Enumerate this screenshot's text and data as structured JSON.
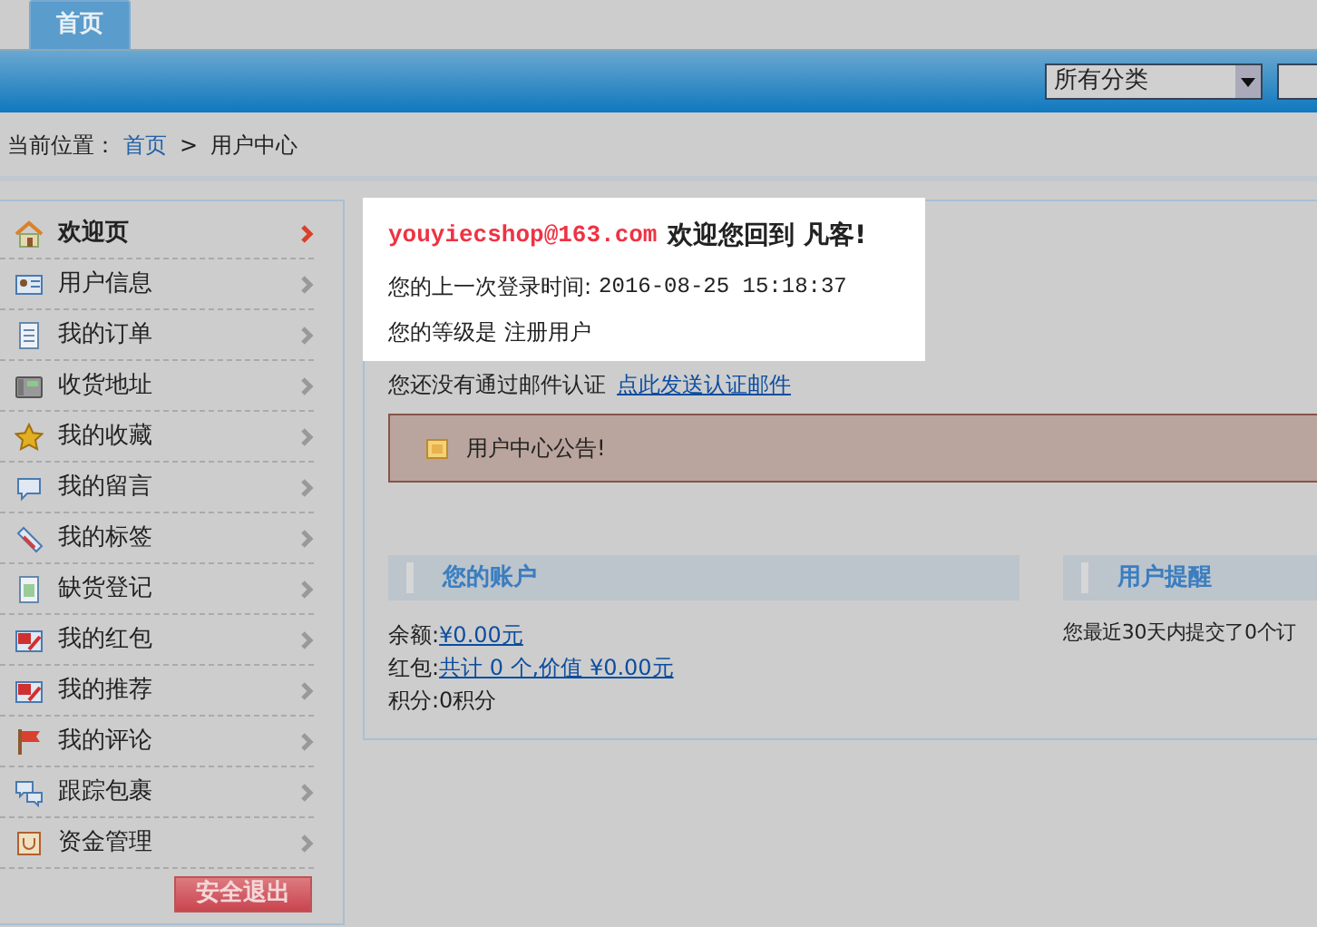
{
  "tabs": [
    {
      "label": "首页",
      "selected": true
    }
  ],
  "search": {
    "category": "所有分类"
  },
  "breadcrumb": {
    "label": "当前位置：",
    "home": "首页",
    "separator": ">",
    "current": "用户中心"
  },
  "sidebar": {
    "items": [
      {
        "label": "欢迎页",
        "selected": true
      },
      {
        "label": "用户信息",
        "selected": false
      },
      {
        "label": "我的订单",
        "selected": false
      },
      {
        "label": "收货地址",
        "selected": false
      },
      {
        "label": "我的收藏",
        "selected": false
      },
      {
        "label": "我的留言",
        "selected": false
      },
      {
        "label": "我的标签",
        "selected": false
      },
      {
        "label": "缺货登记",
        "selected": false
      },
      {
        "label": "我的红包",
        "selected": false
      },
      {
        "label": "我的推荐",
        "selected": false
      },
      {
        "label": "我的评论",
        "selected": false
      },
      {
        "label": "跟踪包裹",
        "selected": false
      },
      {
        "label": "资金管理",
        "selected": false
      }
    ],
    "logout": "安全退出"
  },
  "welcome": {
    "email": "youyiecshop@163.com",
    "greeting": "欢迎您回到 凡客!",
    "last_login_label": "您的上一次登录时间:",
    "last_login": "2016-08-25 15:18:37",
    "rank": "您的等级是 注册用户",
    "email_notice": "您还没有通过邮件认证",
    "email_link": "点此发送认证邮件"
  },
  "notice": "用户中心公告!",
  "account": {
    "title": "您的账户",
    "rows": [
      {
        "label": "余额:",
        "value": "¥0.00元",
        "link": true
      },
      {
        "label": "红包:",
        "value": "共计 0 个,价值 ¥0.00元",
        "link": true
      },
      {
        "label": "积分:",
        "value": "0积分",
        "link": false
      }
    ]
  },
  "remind": {
    "title": "用户提醒",
    "text": "您最近30天内提交了0个订"
  }
}
